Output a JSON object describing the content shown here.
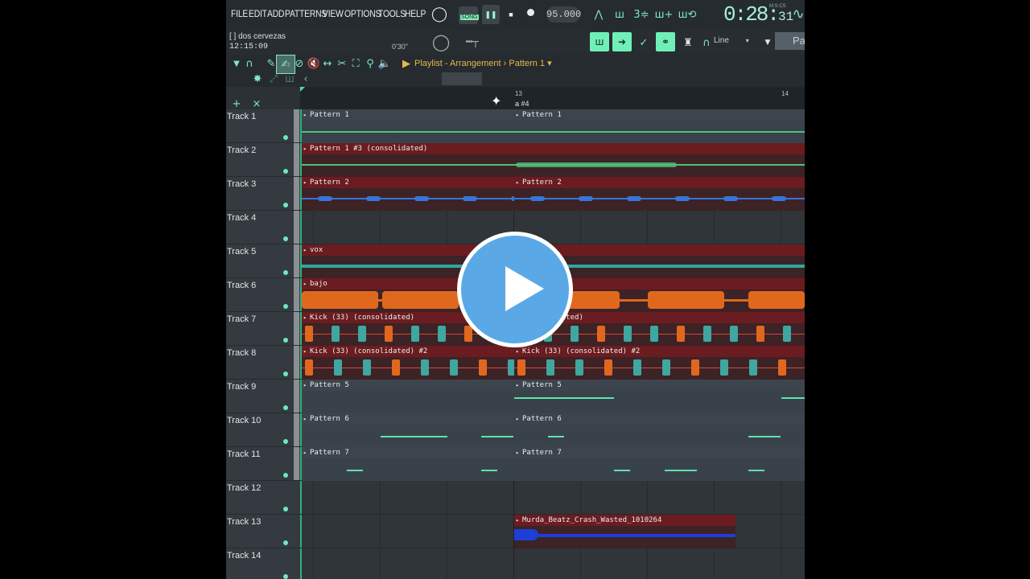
{
  "menu": [
    "FILE",
    "EDIT",
    "ADD",
    "PATTERNS",
    "VIEW",
    "OPTIONS",
    "TOOLS",
    "HELP"
  ],
  "transport": {
    "mode": "SONG",
    "tempo": "95.000",
    "time_main": "0:28",
    "time_sub": "31",
    "time_unit": "M:S:CS"
  },
  "info": {
    "hint": "[ ] dos cervezas",
    "clock": "12:15:09",
    "duration": "0'30\""
  },
  "snap": {
    "label": "Line",
    "pattern_partial": "Pa"
  },
  "playlist": {
    "title": "Playlist - Arrangement",
    "separator": "›",
    "pattern": "Pattern 1"
  },
  "ruler": {
    "bar13": "13",
    "bar14": "14",
    "marker": "a #4"
  },
  "tracks": [
    {
      "name": "Track 1"
    },
    {
      "name": "Track 2"
    },
    {
      "name": "Track 3"
    },
    {
      "name": "Track 4"
    },
    {
      "name": "Track 5"
    },
    {
      "name": "Track 6"
    },
    {
      "name": "Track 7"
    },
    {
      "name": "Track 8"
    },
    {
      "name": "Track 9"
    },
    {
      "name": "Track 10"
    },
    {
      "name": "Track 11"
    },
    {
      "name": "Track 12"
    },
    {
      "name": "Track 13"
    },
    {
      "name": "Track 14"
    }
  ],
  "clips": [
    {
      "track": 0,
      "kind": "pattern",
      "label": "Pattern 1"
    },
    {
      "track": 0,
      "kind": "pattern",
      "label": "Pattern 1"
    },
    {
      "track": 1,
      "kind": "audio",
      "label": "Pattern 1 #3 (consolidated)"
    },
    {
      "track": 2,
      "kind": "audio",
      "label": "Pattern 2"
    },
    {
      "track": 2,
      "kind": "audio",
      "label": "Pattern 2"
    },
    {
      "track": 4,
      "kind": "audio",
      "label": "vox"
    },
    {
      "track": 5,
      "kind": "audio",
      "label": "bajo"
    },
    {
      "track": 6,
      "kind": "audio",
      "label": "Kick (33) (consolidated)"
    },
    {
      "track": 6,
      "kind": "audio",
      "label": "(consolidated)"
    },
    {
      "track": 7,
      "kind": "audio",
      "label": "Kick (33) (consolidated) #2"
    },
    {
      "track": 7,
      "kind": "audio",
      "label": "Kick (33) (consolidated) #2"
    },
    {
      "track": 8,
      "kind": "pattern",
      "label": "Pattern 5"
    },
    {
      "track": 8,
      "kind": "pattern",
      "label": "Pattern 5"
    },
    {
      "track": 9,
      "kind": "pattern",
      "label": "Pattern 6"
    },
    {
      "track": 9,
      "kind": "pattern",
      "label": "Pattern 6"
    },
    {
      "track": 10,
      "kind": "pattern",
      "label": "Pattern 7"
    },
    {
      "track": 10,
      "kind": "pattern",
      "label": "Pattern 7"
    },
    {
      "track": 12,
      "kind": "audio",
      "label": "Murda_Beatz_Crash_Wasted_1010264"
    }
  ],
  "colors": {
    "accent": "#6ff0b8",
    "clip_red": "#6b1c20",
    "clip_pattern": "#39424a",
    "wave_orange": "#e0681e",
    "wave_blue": "#3576d6",
    "wave_green": "#4fc27a"
  },
  "overlay": {
    "icon": "play-circle-icon"
  }
}
